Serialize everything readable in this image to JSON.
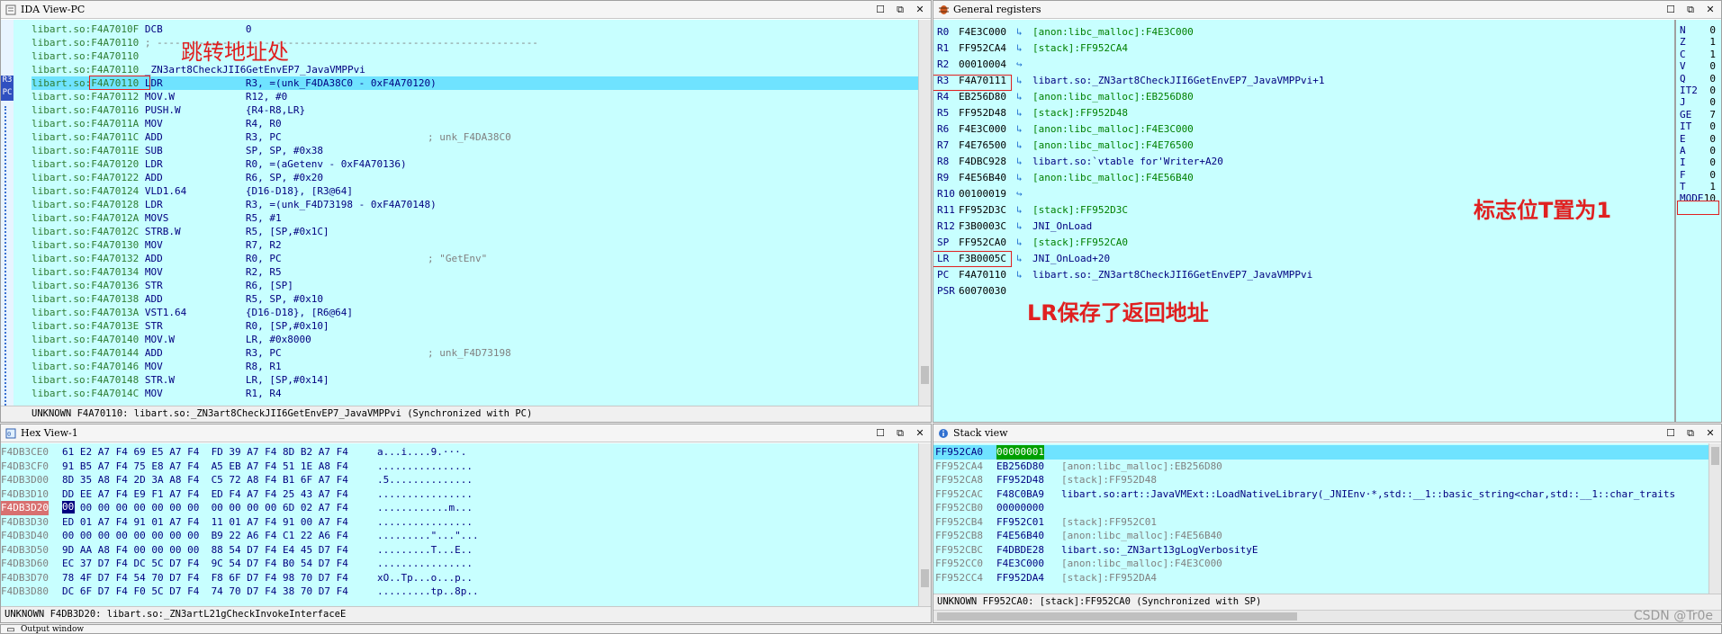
{
  "ida": {
    "title": "IDA View-PC",
    "status": "UNKNOWN F4A70110: libart.so:_ZN3art8CheckJII6GetEnvEP7_JavaVMPPvi (Synchronized with PC)",
    "annotation": "跳转地址处",
    "side_markers": [
      "R3",
      "PC"
    ],
    "lines": [
      {
        "addr": "libart.so:F4A7010F",
        "op": "DCB",
        "args": "0",
        "comment": ""
      },
      {
        "addr": "libart.so:F4A70110",
        "op": "; ----------------------------------------------------------------",
        "args": "",
        "comment": ""
      },
      {
        "addr": "libart.so:F4A70110",
        "op": "",
        "args": "",
        "comment": ""
      },
      {
        "addr": "libart.so:F4A70110",
        "op": "_ZN3art8CheckJII6GetEnvEP7_JavaVMPPvi",
        "args": "",
        "comment": ""
      },
      {
        "addr": "libart.so:F4A70110",
        "op": "LDR",
        "args": "R3, =(unk_F4DA38C0 - 0xF4A70120)",
        "comment": ""
      },
      {
        "addr": "libart.so:F4A70112",
        "op": "MOV.W",
        "args": "R12, #0",
        "comment": ""
      },
      {
        "addr": "libart.so:F4A70116",
        "op": "PUSH.W",
        "args": "{R4-R8,LR}",
        "comment": ""
      },
      {
        "addr": "libart.so:F4A7011A",
        "op": "MOV",
        "args": "R4, R0",
        "comment": ""
      },
      {
        "addr": "libart.so:F4A7011C",
        "op": "ADD",
        "args": "R3, PC",
        "comment": "; unk_F4DA38C0"
      },
      {
        "addr": "libart.so:F4A7011E",
        "op": "SUB",
        "args": "SP, SP, #0x38",
        "comment": ""
      },
      {
        "addr": "libart.so:F4A70120",
        "op": "LDR",
        "args": "R0, =(aGetenv - 0xF4A70136)",
        "comment": ""
      },
      {
        "addr": "libart.so:F4A70122",
        "op": "ADD",
        "args": "R6, SP, #0x20",
        "comment": ""
      },
      {
        "addr": "libart.so:F4A70124",
        "op": "VLD1.64",
        "args": "{D16-D18}, [R3@64]",
        "comment": ""
      },
      {
        "addr": "libart.so:F4A70128",
        "op": "LDR",
        "args": "R3, =(unk_F4D73198 - 0xF4A70148)",
        "comment": ""
      },
      {
        "addr": "libart.so:F4A7012A",
        "op": "MOVS",
        "args": "R5, #1",
        "comment": ""
      },
      {
        "addr": "libart.so:F4A7012C",
        "op": "STRB.W",
        "args": "R5, [SP,#0x1C]",
        "comment": ""
      },
      {
        "addr": "libart.so:F4A70130",
        "op": "MOV",
        "args": "R7, R2",
        "comment": ""
      },
      {
        "addr": "libart.so:F4A70132",
        "op": "ADD",
        "args": "R0, PC",
        "comment": "; \"GetEnv\""
      },
      {
        "addr": "libart.so:F4A70134",
        "op": "MOV",
        "args": "R2, R5",
        "comment": ""
      },
      {
        "addr": "libart.so:F4A70136",
        "op": "STR",
        "args": "R6, [SP]",
        "comment": ""
      },
      {
        "addr": "libart.so:F4A70138",
        "op": "ADD",
        "args": "R5, SP, #0x10",
        "comment": ""
      },
      {
        "addr": "libart.so:F4A7013A",
        "op": "VST1.64",
        "args": "{D16-D18}, [R6@64]",
        "comment": ""
      },
      {
        "addr": "libart.so:F4A7013E",
        "op": "STR",
        "args": "R0, [SP,#0x10]",
        "comment": ""
      },
      {
        "addr": "libart.so:F4A70140",
        "op": "MOV.W",
        "args": "LR, #0x8000",
        "comment": ""
      },
      {
        "addr": "libart.so:F4A70144",
        "op": "ADD",
        "args": "R3, PC",
        "comment": "; unk_F4D73198"
      },
      {
        "addr": "libart.so:F4A70146",
        "op": "MOV",
        "args": "R8, R1",
        "comment": ""
      },
      {
        "addr": "libart.so:F4A70148",
        "op": "STR.W",
        "args": "LR, [SP,#0x14]",
        "comment": ""
      },
      {
        "addr": "libart.so:F4A7014C",
        "op": "MOV",
        "args": "R1, R4",
        "comment": ""
      }
    ]
  },
  "regs": {
    "title": "General registers",
    "annotation_lr": "LR保存了返回地址",
    "annotation_t": "标志位T置为1",
    "rows": [
      {
        "name": "R0",
        "value": "F4E3C000",
        "desc": "[anon:libc_malloc]:F4E3C000"
      },
      {
        "name": "R1",
        "value": "FF952CA4",
        "desc": "[stack]:FF952CA4"
      },
      {
        "name": "R2",
        "value": "00010004",
        "desc": ""
      },
      {
        "name": "R3",
        "value": "F4A70111",
        "desc": "libart.so:_ZN3art8CheckJII6GetEnvEP7_JavaVMPPvi+1"
      },
      {
        "name": "R4",
        "value": "EB256D80",
        "desc": "[anon:libc_malloc]:EB256D80"
      },
      {
        "name": "R5",
        "value": "FF952D48",
        "desc": "[stack]:FF952D48"
      },
      {
        "name": "R6",
        "value": "F4E3C000",
        "desc": "[anon:libc_malloc]:F4E3C000"
      },
      {
        "name": "R7",
        "value": "F4E76500",
        "desc": "[anon:libc_malloc]:F4E76500"
      },
      {
        "name": "R8",
        "value": "F4DBC928",
        "desc": "libart.so:`vtable for'Writer+A20"
      },
      {
        "name": "R9",
        "value": "F4E56B40",
        "desc": "[anon:libc_malloc]:F4E56B40"
      },
      {
        "name": "R10",
        "value": "00100019",
        "desc": ""
      },
      {
        "name": "R11",
        "value": "FF952D3C",
        "desc": "[stack]:FF952D3C"
      },
      {
        "name": "R12",
        "value": "F3B0003C",
        "desc": "JNI_OnLoad"
      },
      {
        "name": "SP",
        "value": "FF952CA0",
        "desc": "[stack]:FF952CA0"
      },
      {
        "name": "LR",
        "value": "F3B0005C",
        "desc": "JNI_OnLoad+20"
      },
      {
        "name": "PC",
        "value": "F4A70110",
        "desc": "libart.so:_ZN3art8CheckJII6GetEnvEP7_JavaVMPPvi"
      },
      {
        "name": "PSR",
        "value": "60070030",
        "desc": ""
      }
    ],
    "flags": [
      {
        "name": "N",
        "value": "0"
      },
      {
        "name": "Z",
        "value": "1"
      },
      {
        "name": "C",
        "value": "1"
      },
      {
        "name": "V",
        "value": "0"
      },
      {
        "name": "Q",
        "value": "0"
      },
      {
        "name": "IT2",
        "value": "0"
      },
      {
        "name": "J",
        "value": "0"
      },
      {
        "name": "GE",
        "value": "7"
      },
      {
        "name": "IT",
        "value": "0"
      },
      {
        "name": "E",
        "value": "0"
      },
      {
        "name": "A",
        "value": "0"
      },
      {
        "name": "I",
        "value": "0"
      },
      {
        "name": "F",
        "value": "0"
      },
      {
        "name": "T",
        "value": "1"
      },
      {
        "name": "MODE",
        "value": "10"
      }
    ]
  },
  "hex": {
    "title": "Hex View-1",
    "status": "UNKNOWN F4DB3D20: libart.so:_ZN3artL21gCheckInvokeInterfaceE",
    "rows": [
      {
        "addr": "F4DB3CE0",
        "bytes": "61 E2 A7 F4 69 E5 A7 F4  FD 39 A7 F4 8D B2 A7 F4",
        "ascii": "a...i....9.···."
      },
      {
        "addr": "F4DB3CF0",
        "bytes": "91 B5 A7 F4 75 E8 A7 F4  A5 EB A7 F4 51 1E A8 F4",
        "ascii": "................"
      },
      {
        "addr": "F4DB3D00",
        "bytes": "8D 35 A8 F4 2D 3A A8 F4  C5 72 A8 F4 B1 6F A7 F4",
        "ascii": ".5.............."
      },
      {
        "addr": "F4DB3D10",
        "bytes": "DD EE A7 F4 E9 F1 A7 F4  ED F4 A7 F4 25 43 A7 F4",
        "ascii": "................"
      },
      {
        "addr": "F4DB3D20",
        "bytes": "00 00 00 00 00 00 00 00  00 00 00 00 6D 02 A7 F4",
        "ascii": "............m..."
      },
      {
        "addr": "F4DB3D30",
        "bytes": "ED 01 A7 F4 91 01 A7 F4  11 01 A7 F4 91 00 A7 F4",
        "ascii": "................"
      },
      {
        "addr": "F4DB3D40",
        "bytes": "00 00 00 00 00 00 00 00  B9 22 A6 F4 C1 22 A6 F4",
        "ascii": ".........\"...\"..."
      },
      {
        "addr": "F4DB3D50",
        "bytes": "9D AA A8 F4 00 00 00 00  88 54 D7 F4 E4 45 D7 F4",
        "ascii": ".........T...E.."
      },
      {
        "addr": "F4DB3D60",
        "bytes": "EC 37 D7 F4 DC 5C D7 F4  9C 54 D7 F4 B0 54 D7 F4",
        "ascii": "................"
      },
      {
        "addr": "F4DB3D70",
        "bytes": "78 4F D7 F4 54 70 D7 F4  F8 6F D7 F4 98 70 D7 F4",
        "ascii": "xO..Tp...o...p.."
      },
      {
        "addr": "F4DB3D80",
        "bytes": "DC 6F D7 F4 F0 5C D7 F4  74 70 D7 F4 38 70 D7 F4",
        "ascii": ".........tp..8p.."
      }
    ]
  },
  "stack": {
    "title": "Stack view",
    "status": "UNKNOWN FF952CA0: [stack]:FF952CA0 (Synchronized with SP)",
    "rows": [
      {
        "addr": "FF952CA0",
        "value": "00000001",
        "desc": ""
      },
      {
        "addr": "FF952CA4",
        "value": "EB256D80",
        "desc": "[anon:libc_malloc]:EB256D80"
      },
      {
        "addr": "FF952CA8",
        "value": "FF952D48",
        "desc": "[stack]:FF952D48"
      },
      {
        "addr": "FF952CAC",
        "value": "F48C0BA9",
        "desc": "libart.so:art::JavaVMExt::LoadNativeLibrary(_JNIEnv·*,std::__1::basic_string<char,std::__1::char_traits"
      },
      {
        "addr": "FF952CB0",
        "value": "00000000",
        "desc": ""
      },
      {
        "addr": "FF952CB4",
        "value": "FF952C01",
        "desc": "[stack]:FF952C01"
      },
      {
        "addr": "FF952CB8",
        "value": "F4E56B40",
        "desc": "[anon:libc_malloc]:F4E56B40"
      },
      {
        "addr": "FF952CBC",
        "value": "F4DBDE28",
        "desc": "libart.so:_ZN3art13gLogVerbosityE"
      },
      {
        "addr": "FF952CC0",
        "value": "F4E3C000",
        "desc": "[anon:libc_malloc]:F4E3C000"
      },
      {
        "addr": "FF952CC4",
        "value": "FF952DA4",
        "desc": "[stack]:FF952DA4"
      }
    ]
  },
  "output": {
    "title": "Output window"
  },
  "watermark": "CSDN @Tr0e"
}
